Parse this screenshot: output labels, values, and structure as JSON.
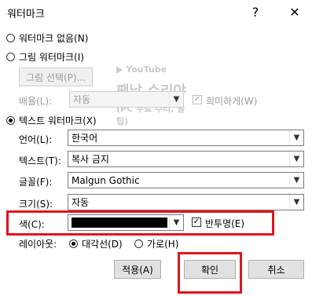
{
  "dialog": {
    "title": "워터마크",
    "help_label": "?",
    "close_label": "✕"
  },
  "options": {
    "none_label": "워터마크 없음(N)",
    "picture_label": "그림 워터마크(I)",
    "select_picture_button": "그림 선택(P)...",
    "scale_label": "배율(L):",
    "scale_value": "자동",
    "washout_label": "희미하게(W)",
    "text_label": "텍스트 워터마크(X)"
  },
  "text_watermark": {
    "language_label": "언어(L):",
    "language_value": "한국어",
    "text_label": "텍스트(T):",
    "text_value": "복사 금지",
    "font_label": "글꼴(F):",
    "font_value": "Malgun Gothic",
    "size_label": "크기(S):",
    "size_value": "자동",
    "color_label": "색(C):",
    "color_value": "#000000",
    "semitransparent_label": "반투명(E)",
    "layout_label": "레이아웃:",
    "diagonal_label": "대각선(D)",
    "horizontal_label": "가로(H)"
  },
  "buttons": {
    "apply": "적용(A)",
    "ok": "확인",
    "cancel": "취소"
  },
  "overlay_watermark": {
    "line1": "YouTube",
    "line2": "팬날 수리야",
    "line3": "(PC 무료 수리, 꿀팁)"
  },
  "colors": {
    "highlight_red": "#e0141c",
    "swatch": "#000000"
  }
}
